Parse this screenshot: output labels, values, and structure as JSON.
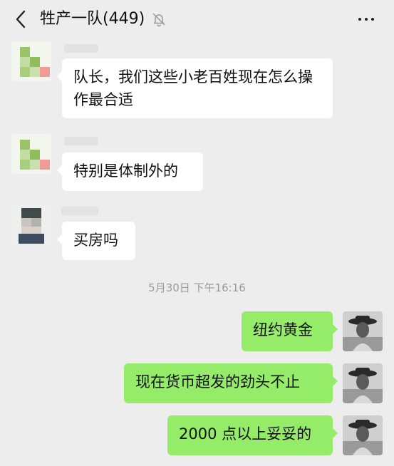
{
  "header": {
    "title": "牲产一队(449)",
    "back_icon": "chevron-left-icon",
    "mute_icon": "bell-off-icon",
    "more_icon": "more-dots-icon"
  },
  "messages_in": [
    {
      "text": "队长，我们这些小老百姓现在怎么操作最合适"
    },
    {
      "text": "特别是体制外的"
    },
    {
      "text": "买房吗"
    }
  ],
  "timestamp": "5月30日 下午16:16",
  "messages_out": [
    {
      "text": "纽约黄金"
    },
    {
      "text": "现在货币超发的劲头不止"
    },
    {
      "text": "2000 点以上妥妥的"
    }
  ],
  "colors": {
    "background": "#ededed",
    "bubble_in": "#ffffff",
    "bubble_out": "#95ec69"
  }
}
